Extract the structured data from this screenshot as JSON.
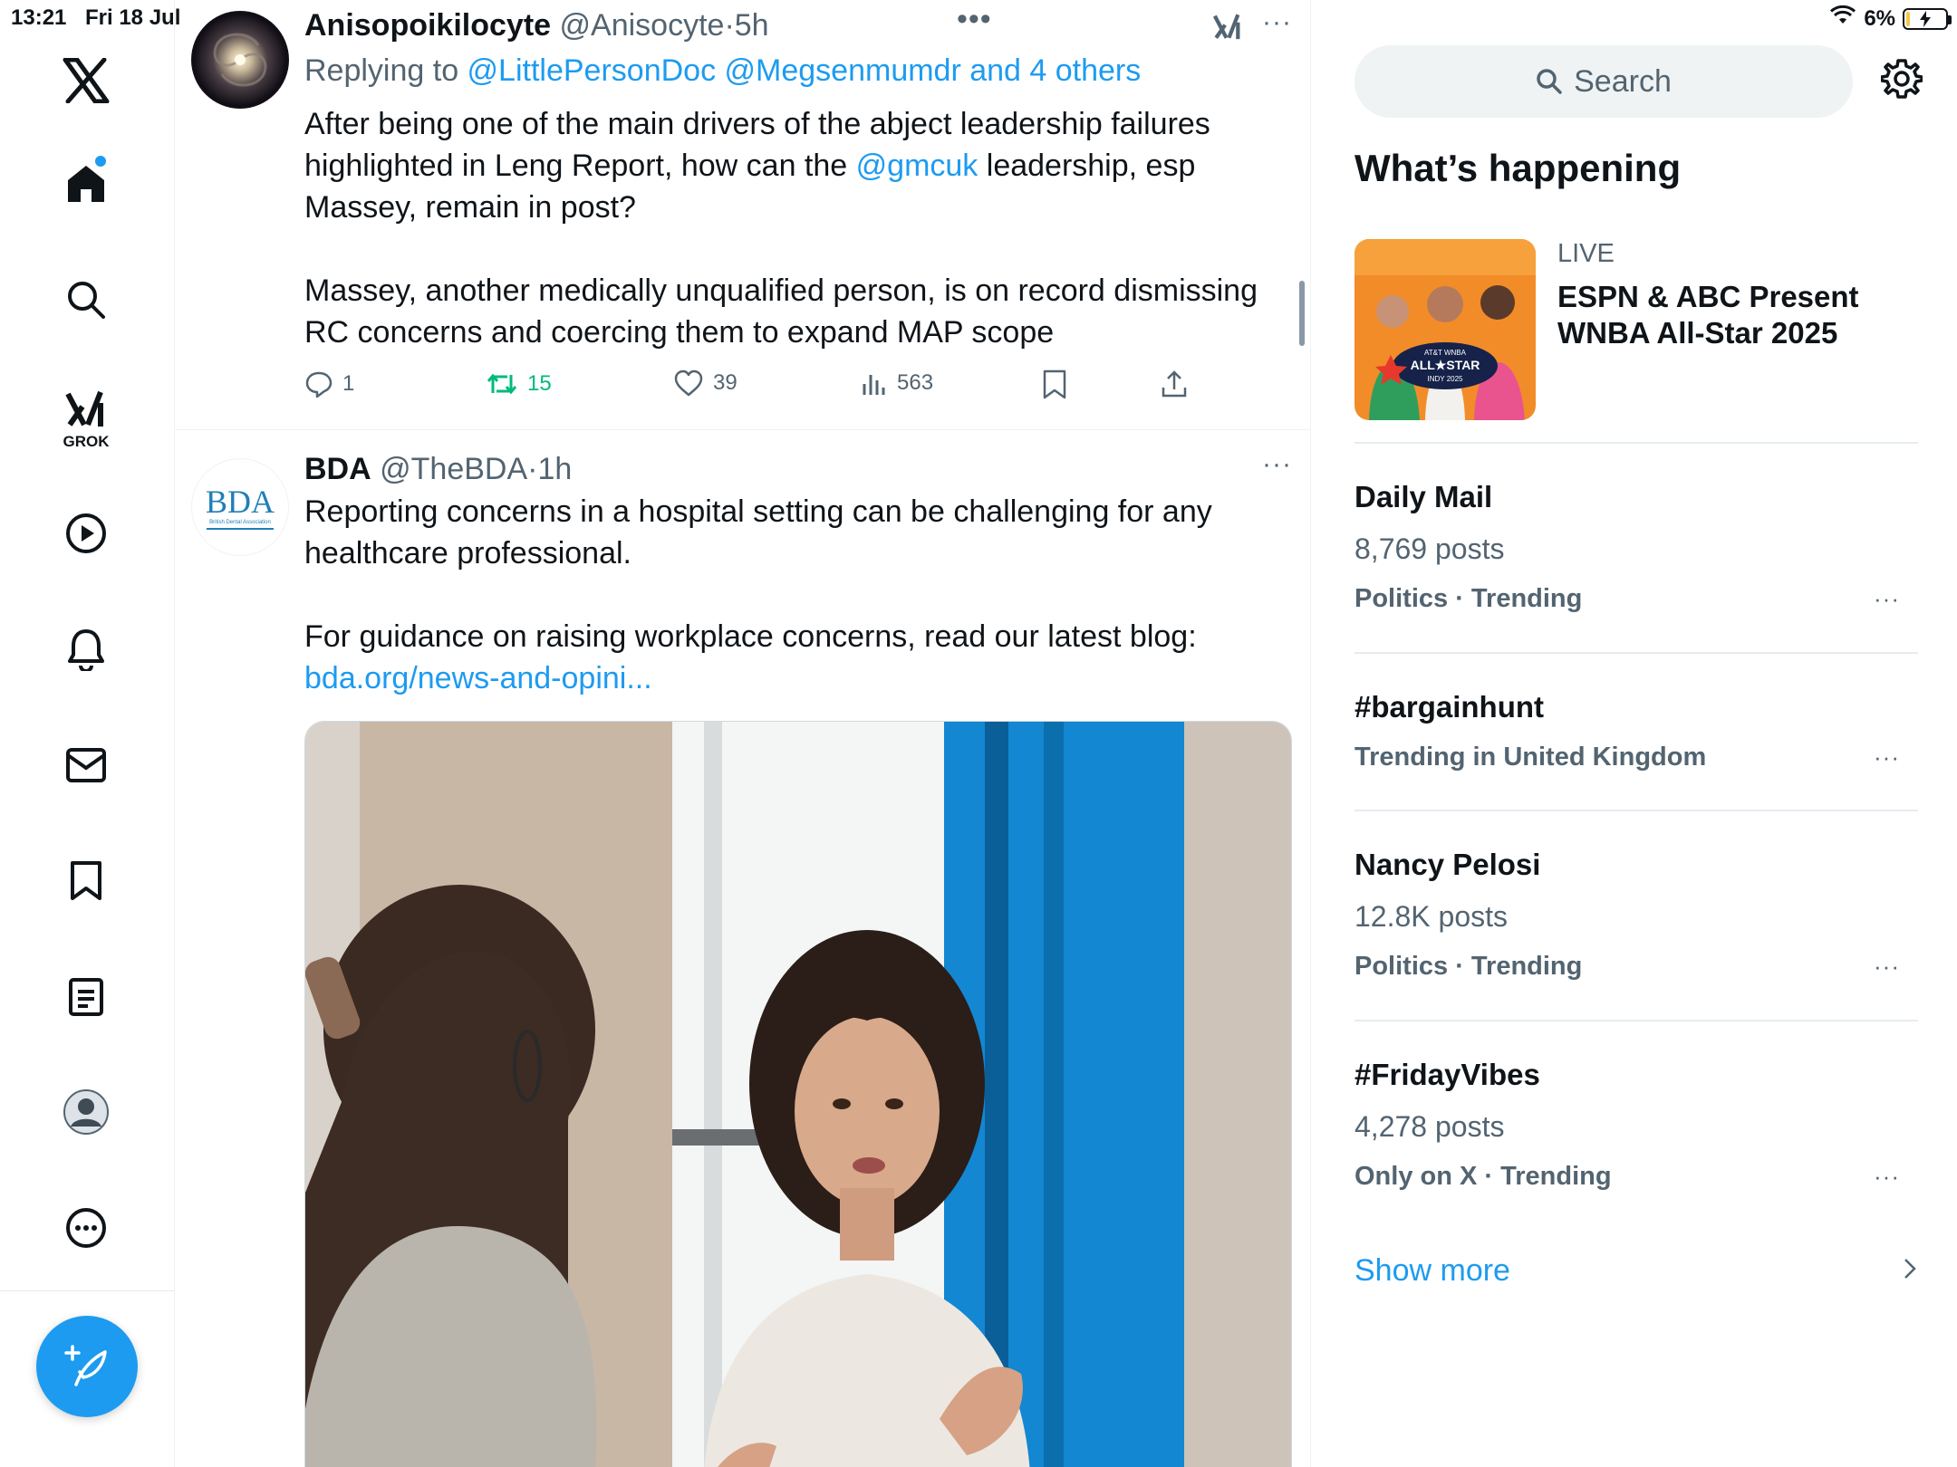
{
  "status": {
    "time": "13:21",
    "date": "Fri 18 Jul",
    "battery": "6%"
  },
  "nav": {
    "grok_label": "GROK"
  },
  "tweet1": {
    "name": "Anisopoikilocyte",
    "handle": "@Anisocyte",
    "dot": "·",
    "time": "5h",
    "replying_prefix": "Replying to ",
    "replying_to": "@LittlePersonDoc @Megsenmumdr and 4 others",
    "text_a": "After being one of the main drivers of the abject leadership failures highlighted in Leng Report, how can the ",
    "mention": "@gmcuk",
    "text_b": " leadership, esp Massey, remain in post?",
    "text_c": "Massey, another medically unqualified person, is on record dismissing RC concerns and coercing them to expand MAP scope",
    "replies": "1",
    "reposts": "15",
    "likes": "39",
    "views": "563"
  },
  "tweet2": {
    "name": "BDA",
    "handle": "@TheBDA",
    "dot": "·",
    "time": "1h",
    "avatar_text": "BDA",
    "avatar_sub": "British Dental Association",
    "text_a": "Reporting concerns in a hospital setting can be challenging for any healthcare professional.",
    "text_b": "For guidance on raising workplace concerns, read our latest blog:",
    "link": "bda.org/news-and-opini..."
  },
  "sidebar": {
    "search_placeholder": "Search",
    "title": "What’s happening",
    "live": {
      "tag": "LIVE",
      "title": "ESPN & ABC Present WNBA All-Star 2025",
      "badge_top": "AT&T WNBA",
      "badge_mid": "ALL★STAR",
      "badge_bot": "INDY 2025"
    },
    "trends": [
      {
        "name": "Daily Mail",
        "count": "8,769 posts",
        "category": "Politics · Trending"
      },
      {
        "name": "#bargainhunt",
        "count": "",
        "category": "Trending in United Kingdom"
      },
      {
        "name": "Nancy Pelosi",
        "count": "12.8K posts",
        "category": "Politics · Trending"
      },
      {
        "name": "#FridayVibes",
        "count": "4,278 posts",
        "category": "Only on X · Trending"
      }
    ],
    "show_more": "Show more"
  },
  "colors": {
    "accent": "#1d9bf0",
    "repost_active": "#00ba7c",
    "secondary_text": "#536471"
  }
}
